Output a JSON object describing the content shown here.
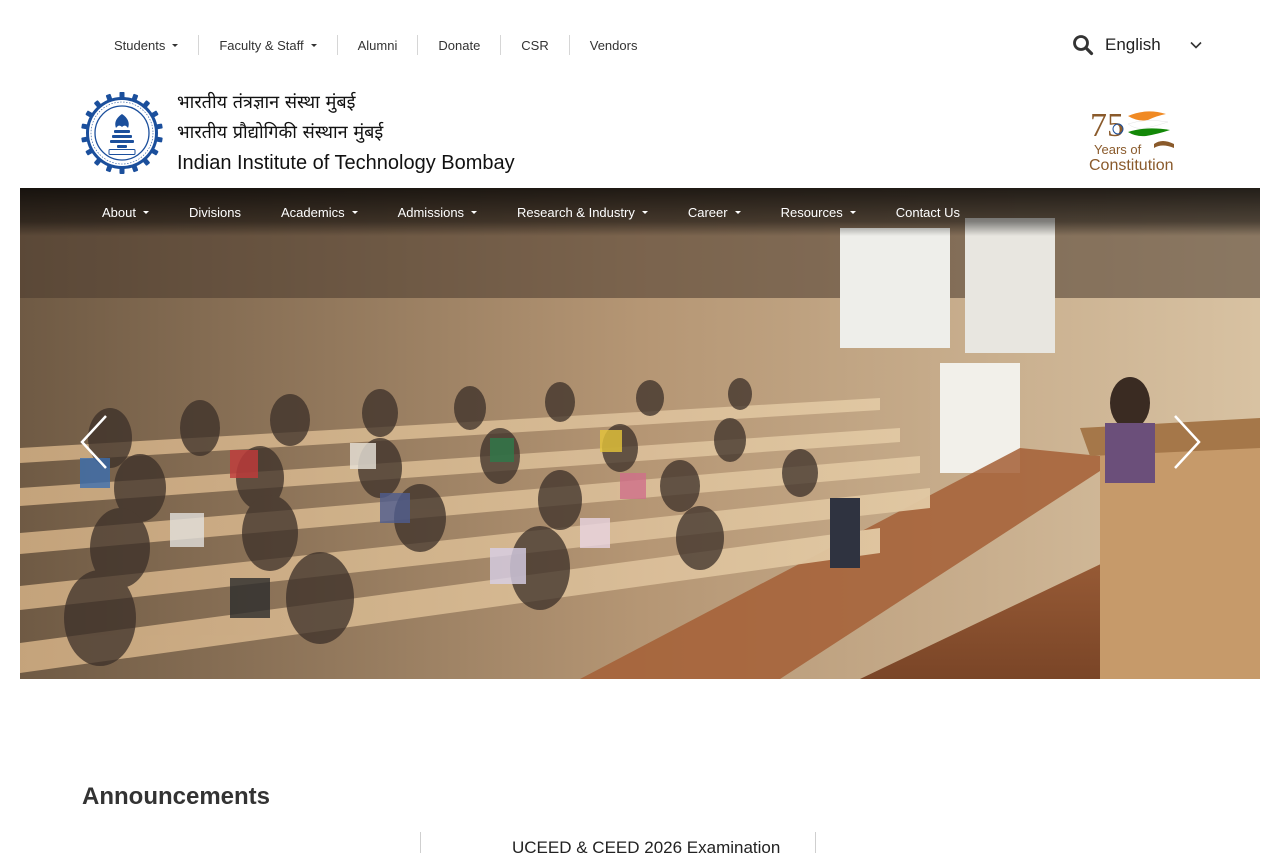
{
  "utility_nav": {
    "items": [
      {
        "label": "Students",
        "dropdown": true
      },
      {
        "label": "Faculty & Staff",
        "dropdown": true
      },
      {
        "label": "Alumni",
        "dropdown": false
      },
      {
        "label": "Donate",
        "dropdown": false
      },
      {
        "label": "CSR",
        "dropdown": false
      },
      {
        "label": "Vendors",
        "dropdown": false
      }
    ],
    "search_icon": "search-icon",
    "language": "English"
  },
  "brand": {
    "line_hindi_1": "भारतीय तंत्रज्ञान संस्था मुंबई",
    "line_hindi_2": "भारतीय प्रौद्योगिकी संस्थान मुंबई",
    "line_english": "Indian Institute of Technology Bombay",
    "badge_text_top": "Years of",
    "badge_text_bottom": "Constitution",
    "badge_number": "75"
  },
  "main_nav": {
    "items": [
      {
        "label": "About",
        "dropdown": true
      },
      {
        "label": "Divisions",
        "dropdown": false
      },
      {
        "label": "Academics",
        "dropdown": true
      },
      {
        "label": "Admissions",
        "dropdown": true
      },
      {
        "label": "Research & Industry",
        "dropdown": true
      },
      {
        "label": "Career",
        "dropdown": true
      },
      {
        "label": "Resources",
        "dropdown": true
      },
      {
        "label": "Contact Us",
        "dropdown": false
      }
    ]
  },
  "announcements": {
    "title": "Announcements",
    "first_item": "UCEED & CEED 2026 Examination"
  },
  "colors": {
    "saffron": "#f08a24",
    "green": "#138808",
    "logo_blue": "#1b4f9c"
  }
}
